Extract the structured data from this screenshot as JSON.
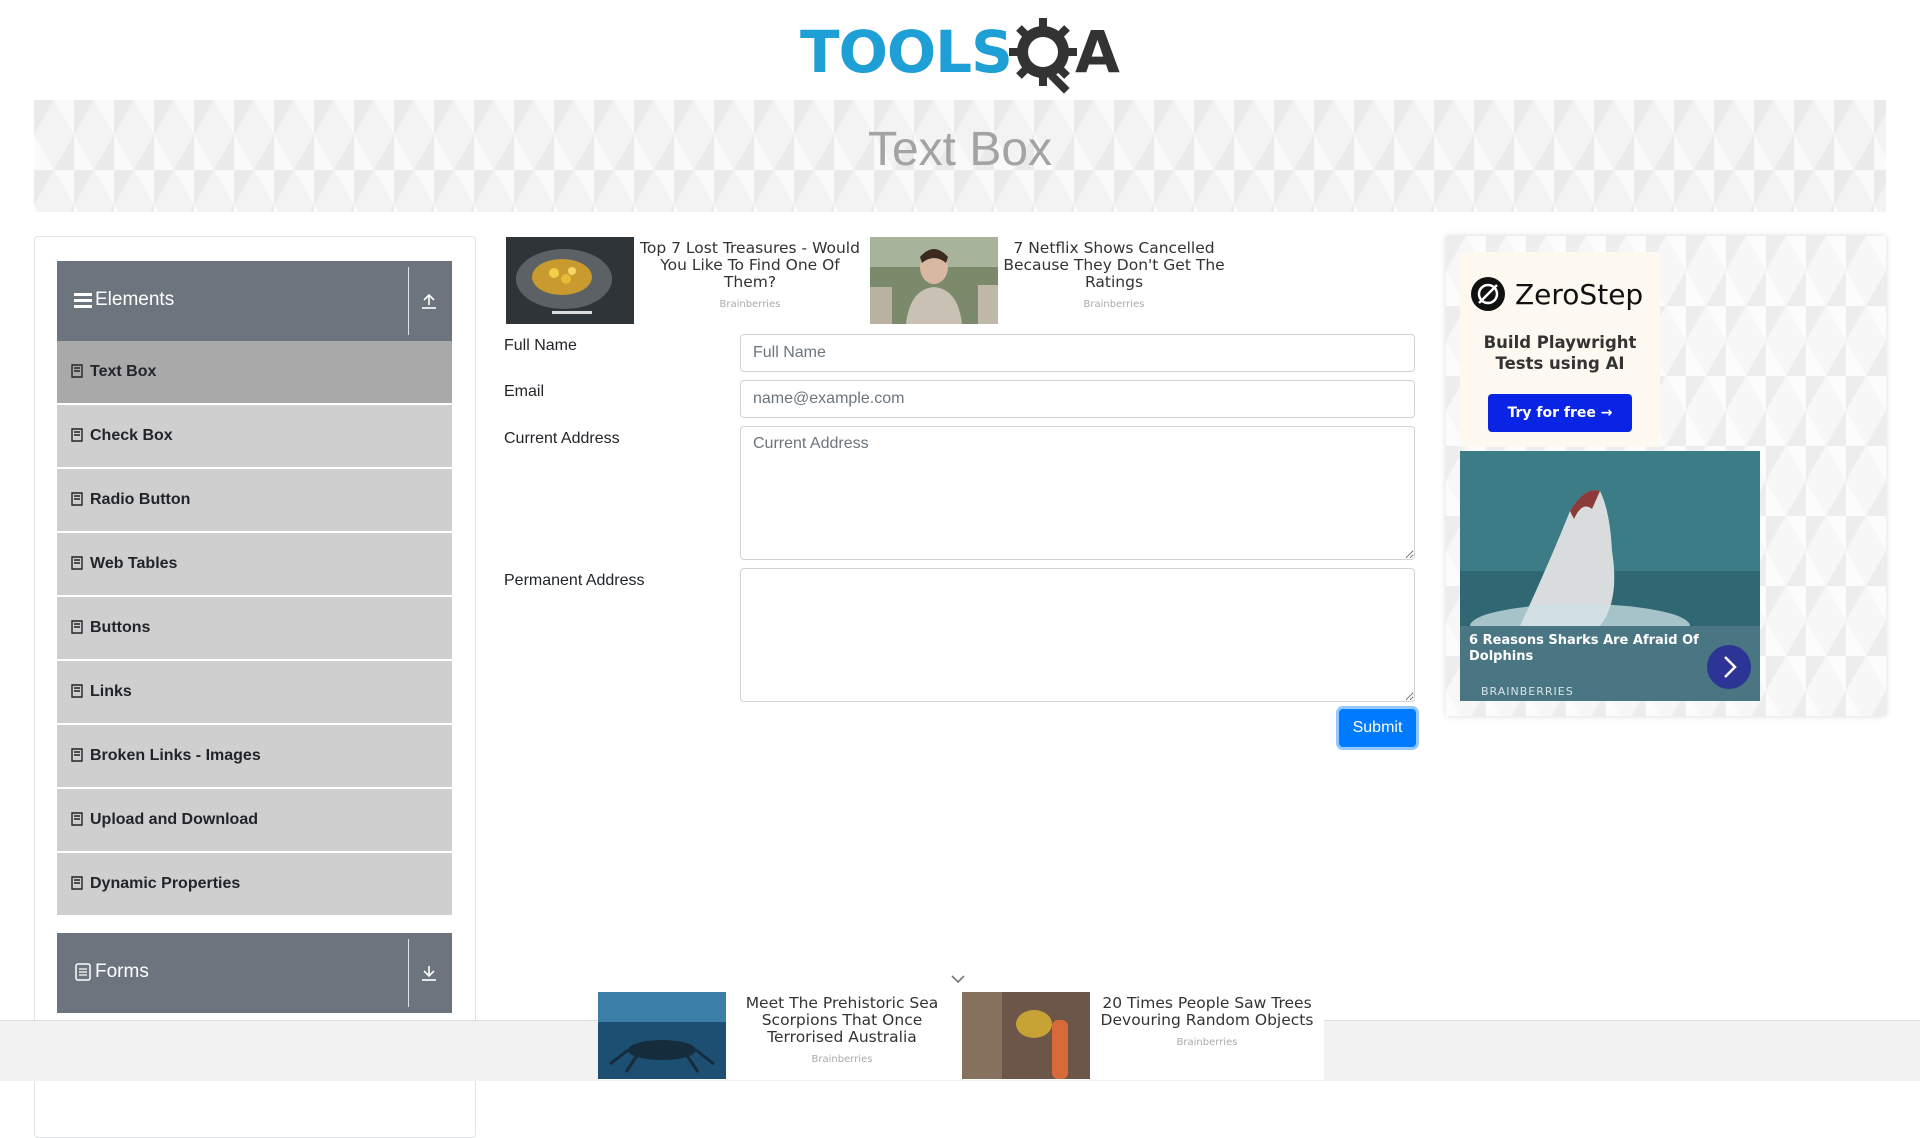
{
  "header": {
    "logo_left": "TOOLS",
    "logo_right": "A",
    "page_title": "Text Box"
  },
  "sidebar": {
    "elements_group": {
      "label": "Elements"
    },
    "items": [
      {
        "label": "Text Box",
        "active": true
      },
      {
        "label": "Check Box"
      },
      {
        "label": "Radio Button"
      },
      {
        "label": "Web Tables"
      },
      {
        "label": "Buttons"
      },
      {
        "label": "Links"
      },
      {
        "label": "Broken Links - Images"
      },
      {
        "label": "Upload and Download"
      },
      {
        "label": "Dynamic Properties"
      }
    ],
    "forms_group": {
      "label": "Forms"
    }
  },
  "ads_top": [
    {
      "title": "Top 7 Lost Treasures - Would You Like To Find One Of Them?",
      "source": "Brainberries"
    },
    {
      "title": "7 Netflix Shows Cancelled Because They Don't Get The Ratings",
      "source": "Brainberries"
    }
  ],
  "form": {
    "full_name": {
      "label": "Full Name",
      "placeholder": "Full Name",
      "value": ""
    },
    "email": {
      "label": "Email",
      "placeholder": "name@example.com",
      "value": ""
    },
    "current_address": {
      "label": "Current Address",
      "placeholder": "Current Address",
      "value": ""
    },
    "permanent_address": {
      "label": "Permanent Address",
      "placeholder": "",
      "value": ""
    },
    "submit_label": "Submit"
  },
  "right_ad": {
    "brand": "ZeroStep",
    "tagline": "Build Playwright Tests using AI",
    "cta": "Try for free →",
    "story": {
      "title": "6 Reasons Sharks Are Afraid Of Dolphins",
      "source": "BRAINBERRIES"
    }
  },
  "ads_bottom": [
    {
      "title": "Meet The Prehistoric Sea Scorpions That Once Terrorised Australia",
      "source": "Brainberries"
    },
    {
      "title": "20 Times People Saw Trees Devouring Random Objects",
      "source": "Brainberries"
    }
  ],
  "colors": {
    "accent": "#007bff",
    "group_header": "#6c757d",
    "menu_item": "#cfcfcf",
    "menu_active": "#a9a9a9",
    "logo_blue": "#1e9fd6"
  },
  "icons": {
    "menu_item": "book-icon",
    "elements_group": "hamburger-icon",
    "forms_group": "document-icon"
  }
}
